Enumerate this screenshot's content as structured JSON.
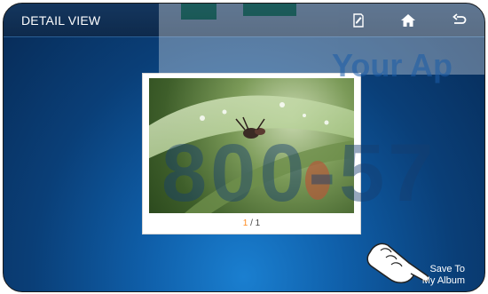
{
  "header": {
    "title": "DETAIL VIEW"
  },
  "toolbar": {
    "icons": [
      "edit-memo-icon",
      "home-icon",
      "back-arrow-icon"
    ]
  },
  "viewer": {
    "page_current": "1",
    "page_separator": "/",
    "page_total": "1"
  },
  "actions": {
    "save_line1": "Save To",
    "save_line2": "My Album"
  },
  "watermark": {
    "text_line1": "Your Ap",
    "text_line2": "800-57"
  },
  "colors": {
    "accent_page": "#ff8a1e",
    "topbar": "#14365e",
    "background": "#0f5ea8"
  }
}
